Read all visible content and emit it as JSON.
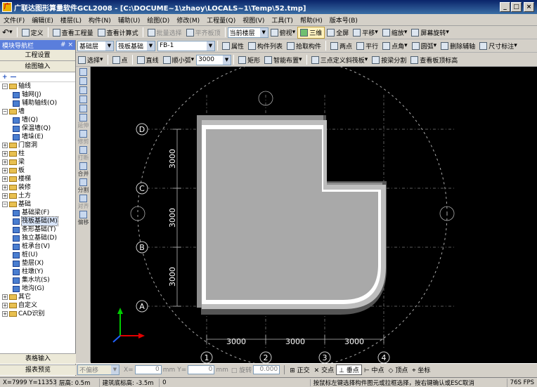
{
  "window": {
    "title": "广联达图形算量软件GCL2008 - [C:\\DOCUME~1\\zhaoy\\LOCALS~1\\Temp\\52.tmp]",
    "min": "_",
    "max": "□",
    "close": "×"
  },
  "menu": [
    "文件(F)",
    "编辑(E)",
    "楼层(L)",
    "构件(N)",
    "辅助(U)",
    "绘图(D)",
    "修改(M)",
    "工程量(Q)",
    "视图(V)",
    "工具(T)",
    "帮助(H)",
    "版本号(B)"
  ],
  "tb1": {
    "undo": "↶",
    "define": "定义",
    "view_qty": "查看工程量",
    "view_formula": "查看计算式",
    "batch_select": "批量选择",
    "flat_board": "平齐板顶",
    "floor_select": "当前楼层",
    "top_view": "俯视",
    "three_d": "三维",
    "fullscreen": "全屏",
    "pan": "平移",
    "zoom": "缩放",
    "screen_rotate": "屏幕旋转"
  },
  "tb2": {
    "layer": "基础层",
    "comp_type": "筏板基础",
    "comp_name": "FB-1",
    "attr": "属性",
    "comp_list": "构件列表",
    "pick": "拾取构件",
    "two_point": "两点",
    "parallel": "平行",
    "point_angle": "点角",
    "arc": "圆弧",
    "del_axis": "删除辅轴",
    "dim": "尺寸标注"
  },
  "tb3": {
    "select": "选择",
    "point": "点",
    "line": "直线",
    "arc_small": "顺小弧",
    "radius": "3000",
    "rect": "矩形",
    "smart": "智能布置",
    "three_pt_slope": "三点定义斜筏板",
    "by_beam": "按梁分割",
    "view_top": "查看板顶标高"
  },
  "left": {
    "header": "模块导航栏",
    "pin": "# ×",
    "eng_settings": "工程设置",
    "draw_input": "绘图输入",
    "add": "+",
    "remove": "—",
    "tree": [
      {
        "id": "axis",
        "label": "轴线",
        "level": 0,
        "exp": "−",
        "folder": true
      },
      {
        "id": "axis-grid",
        "label": "轴网(J)",
        "level": 1
      },
      {
        "id": "aux-axis",
        "label": "辅助轴线(O)",
        "level": 1
      },
      {
        "id": "wall",
        "label": "墙",
        "level": 0,
        "exp": "−",
        "folder": true
      },
      {
        "id": "wall-q",
        "label": "墙(Q)",
        "level": 1
      },
      {
        "id": "wall-ins",
        "label": "保温墙(Q)",
        "level": 1
      },
      {
        "id": "wall-dw",
        "label": "墙垛(E)",
        "level": 1
      },
      {
        "id": "door",
        "label": "门窗洞",
        "level": 0,
        "exp": "+",
        "folder": true
      },
      {
        "id": "col",
        "label": "柱",
        "level": 0,
        "exp": "+",
        "folder": true
      },
      {
        "id": "beam",
        "label": "梁",
        "level": 0,
        "exp": "+",
        "folder": true
      },
      {
        "id": "slab",
        "label": "板",
        "level": 0,
        "exp": "+",
        "folder": true
      },
      {
        "id": "stair",
        "label": "楼梯",
        "level": 0,
        "exp": "+",
        "folder": true
      },
      {
        "id": "deco",
        "label": "装修",
        "level": 0,
        "exp": "+",
        "folder": true
      },
      {
        "id": "earth",
        "label": "土方",
        "level": 0,
        "exp": "+",
        "folder": true
      },
      {
        "id": "found",
        "label": "基础",
        "level": 0,
        "exp": "−",
        "folder": true
      },
      {
        "id": "f-beam",
        "label": "基础梁(F)",
        "level": 1
      },
      {
        "id": "f-raft",
        "label": "筏板基础(M)",
        "level": 1,
        "hl": true
      },
      {
        "id": "f-strip",
        "label": "条形基础(T)",
        "level": 1
      },
      {
        "id": "f-iso",
        "label": "独立基础(D)",
        "level": 1
      },
      {
        "id": "f-cap",
        "label": "桩承台(V)",
        "level": 1
      },
      {
        "id": "f-pile",
        "label": "桩(U)",
        "level": 1
      },
      {
        "id": "f-pad",
        "label": "垫层(X)",
        "level": 1
      },
      {
        "id": "f-pier",
        "label": "柱墩(Y)",
        "level": 1
      },
      {
        "id": "f-sump",
        "label": "集水坑(S)",
        "level": 1
      },
      {
        "id": "f-ditch",
        "label": "地沟(G)",
        "level": 1
      },
      {
        "id": "other",
        "label": "其它",
        "level": 0,
        "exp": "+",
        "folder": true
      },
      {
        "id": "custom",
        "label": "自定义",
        "level": 0,
        "exp": "+",
        "folder": true
      },
      {
        "id": "cad",
        "label": "CAD识别",
        "level": 0,
        "exp": "+",
        "folder": true
      }
    ],
    "table_input": "表格输入",
    "report": "报表预览"
  },
  "vtools": [
    "延伸",
    "修剪",
    "打断",
    "合并",
    "分割",
    "对齐",
    "偏移"
  ],
  "axes": {
    "rows": [
      "A",
      "B",
      "C",
      "D"
    ],
    "cols": [
      "1",
      "2",
      "3",
      "4"
    ],
    "row_dims": [
      "3000",
      "3000",
      "3000"
    ],
    "col_dims": [
      "3000",
      "3000",
      "3000"
    ]
  },
  "status1": {
    "no_offset": "不偏移",
    "x_label": "X=",
    "x_val": "0",
    "mm": "mm",
    "y_label": "Y=",
    "y_val": "0",
    "rotate": "旋转",
    "rot_val": "0.000",
    "ortho": "正交",
    "intersect": "交点",
    "perp": "垂点",
    "mid": "中点",
    "vertex": "顶点",
    "coord": "坐标"
  },
  "status2": {
    "xy": "X=7999 Y=11353",
    "floor_h": "层高: 0.5m",
    "bottom": "建筑底标高: -3.5m",
    "zero": "0",
    "hint": "按鼠标左键选择构件图元或拉框选择，按右键确认或ESC取消",
    "fps": "76S FPS"
  }
}
